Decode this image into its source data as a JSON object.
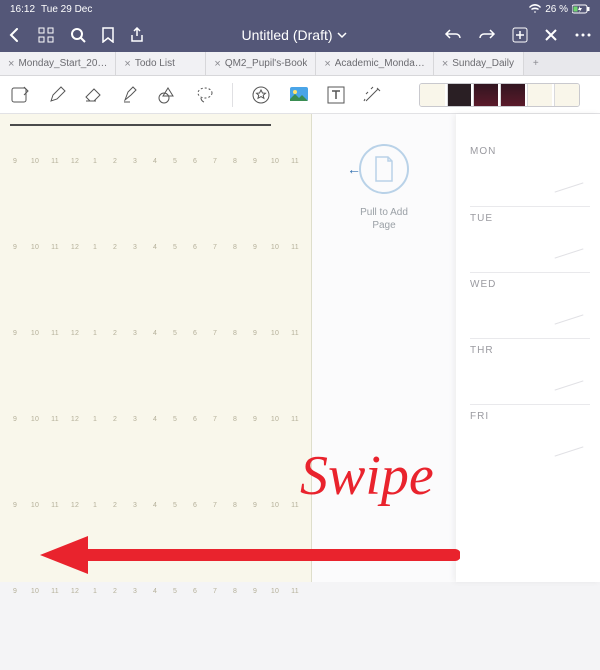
{
  "status": {
    "time": "16:12",
    "date": "Tue 29 Dec",
    "battery_pct": "26 %"
  },
  "header": {
    "title": "Untitled (Draft)"
  },
  "tabs": [
    {
      "label": "Monday_Start_20…",
      "active": false
    },
    {
      "label": "Todo List",
      "active": false
    },
    {
      "label": "QM2_Pupil's-Book",
      "active": false
    },
    {
      "label": "Academic_Monda…",
      "active": false
    },
    {
      "label": "Sunday_Daily",
      "active": false
    }
  ],
  "pull": {
    "label": "Pull to Add Page"
  },
  "planner_days": [
    "MON",
    "TUE",
    "WED",
    "THR",
    "FRI"
  ],
  "ruler_values": [
    "9",
    "10",
    "11",
    "12",
    "1",
    "2",
    "3",
    "4",
    "5",
    "6",
    "7",
    "8",
    "9",
    "10",
    "11"
  ],
  "annotation": {
    "text": "Swipe"
  }
}
